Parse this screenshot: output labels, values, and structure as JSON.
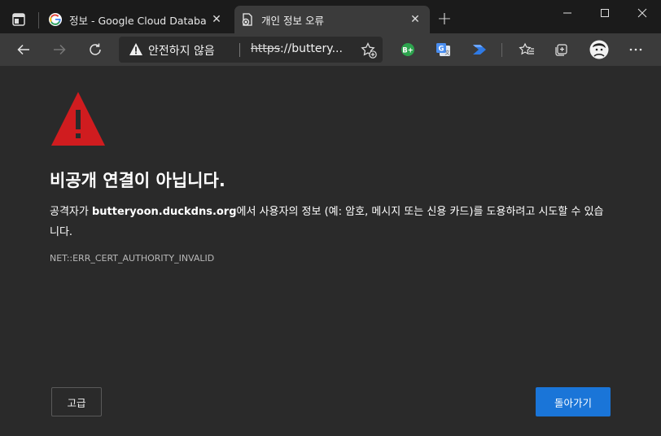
{
  "tabs": [
    {
      "title": "정보 - Google Cloud Database W",
      "close": "✕",
      "favicon": "google-icon"
    },
    {
      "title": "개인 정보 오류",
      "close": "✕",
      "favicon": "page-error-icon"
    }
  ],
  "new_tab": "+",
  "toolbar": {
    "security_label": "안전하지 않음",
    "url_scheme": "https",
    "url_rest": "://buttery...",
    "extensions": [
      {
        "name": "b-plus-extension",
        "label": "B+",
        "color": "#2da44e"
      },
      {
        "name": "google-translate-extension",
        "label": "G",
        "color": "#4a8ef0"
      },
      {
        "name": "power-automate-extension",
        "label": "",
        "color": "#2f7ae5"
      }
    ]
  },
  "page": {
    "heading": "비공개 연결이 아닙니다.",
    "desc_prefix": "공격자가 ",
    "desc_domain": "butteryoon.duckdns.org",
    "desc_suffix": "에서 사용자의 정보 (예: 암호, 메시지 또는 신용 카드)를 도용하려고 시도할 수 있습니다.",
    "error_code": "NET::ERR_CERT_AUTHORITY_INVALID",
    "advanced_button": "고급",
    "back_button": "돌아가기"
  },
  "colors": {
    "background": "#2a2a2a",
    "warning_red": "#d01c1f",
    "primary_button": "#1a75d8",
    "titlebar": "#1b1b1b",
    "toolbar": "#3b3b3b"
  }
}
